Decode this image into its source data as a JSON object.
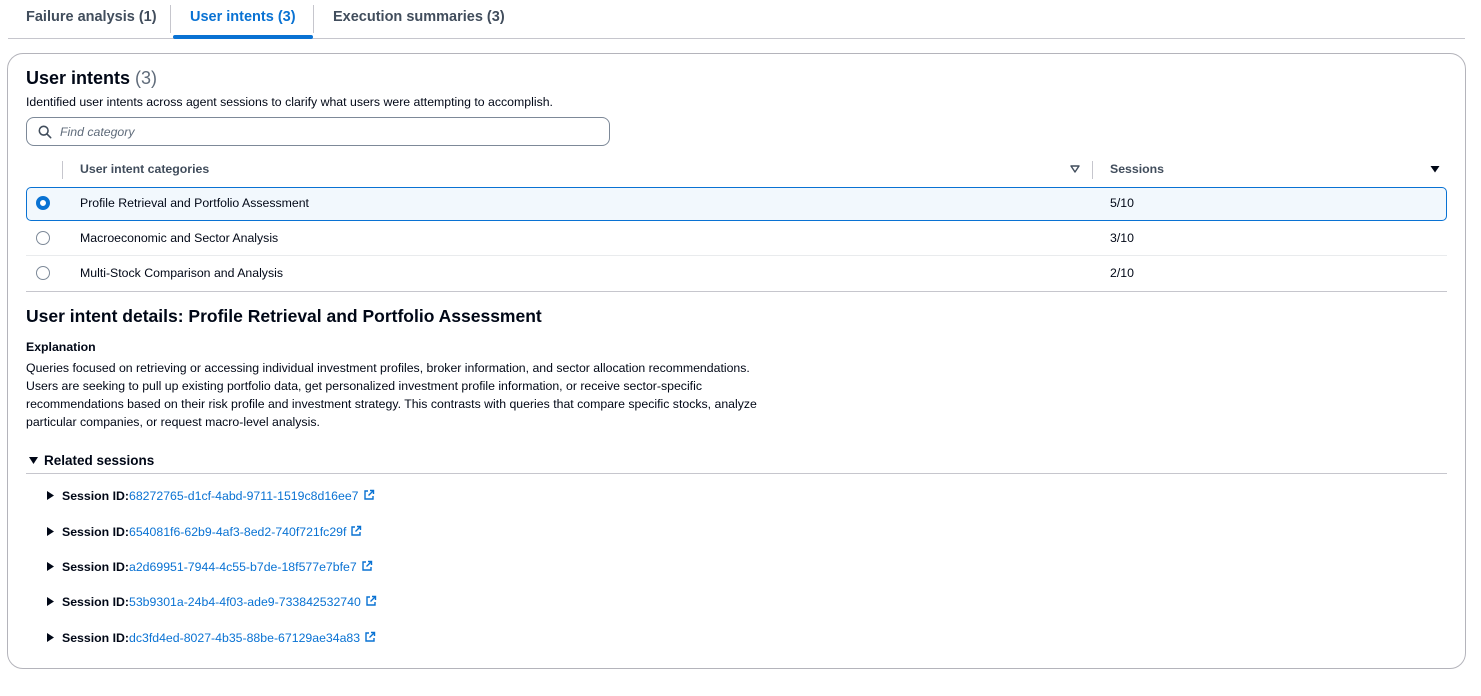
{
  "tabs": [
    {
      "label": "Failure analysis (1)"
    },
    {
      "label": "User intents (3)"
    },
    {
      "label": "Execution summaries (3)"
    }
  ],
  "panel": {
    "title": "User intents",
    "count": "(3)",
    "description": "Identified user intents across agent sessions to clarify what users were attempting to accomplish."
  },
  "search": {
    "placeholder": "Find category",
    "value": ""
  },
  "table": {
    "columns": [
      "User intent categories",
      "Sessions"
    ],
    "rows": [
      {
        "category": "Profile Retrieval and Portfolio Assessment",
        "sessions": "5/10",
        "selected": true
      },
      {
        "category": "Macroeconomic and Sector Analysis",
        "sessions": "3/10",
        "selected": false
      },
      {
        "category": "Multi-Stock Comparison and Analysis",
        "sessions": "2/10",
        "selected": false
      }
    ]
  },
  "details": {
    "title": "User intent details: Profile Retrieval and Portfolio Assessment",
    "explanation_label": "Explanation",
    "explanation": "Queries focused on retrieving or accessing individual investment profiles, broker information, and sector allocation recommendations. Users are seeking to pull up existing portfolio data, get personalized investment profile information, or receive sector-specific recommendations based on their risk profile and investment strategy. This contrasts with queries that compare specific stocks, analyze particular companies, or request macro-level analysis.",
    "related_label": "Related sessions",
    "session_key": "Session ID:",
    "sessions": [
      "68272765-d1cf-4abd-9711-1519c8d16ee7",
      "654081f6-62b9-4af3-8ed2-740f721fc29f",
      "a2d69951-7944-4c55-b7de-18f577e7bfe7",
      "53b9301a-24b4-4f03-ade9-733842532740",
      "dc3fd4ed-8027-4b35-88be-67129ae34a83"
    ]
  },
  "colors": {
    "accent": "#0972d3",
    "text": "#000716",
    "muted": "#5f6b7a",
    "border": "#c6c6cd"
  }
}
